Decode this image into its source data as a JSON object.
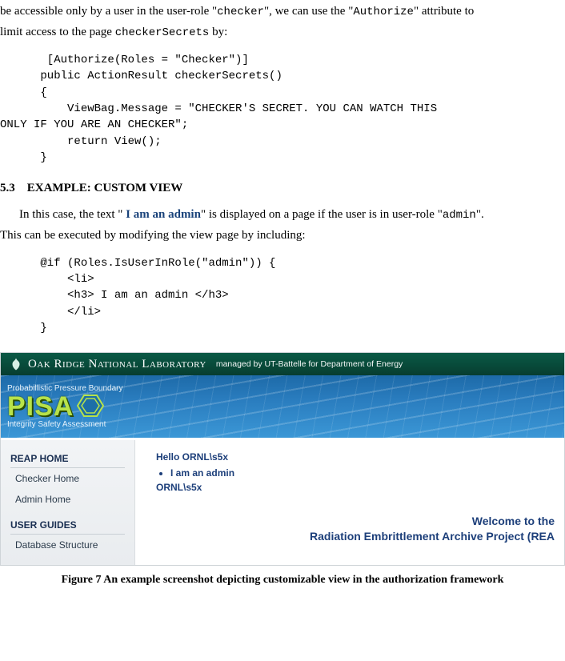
{
  "intro": {
    "line1_pre": "be accessible only by a user in the user-role \"",
    "role_checker": "checker",
    "line1_mid": "\", we can use the \"",
    "attr_authorize": "Authorize",
    "line1_post": "\" attribute to",
    "line2_pre": "limit access to the page ",
    "page_name": "checkerSecrets",
    "line2_post": " by:"
  },
  "code1": "       [Authorize(Roles = \"Checker\")]\n      public ActionResult checkerSecrets()\n      {\n          ViewBag.Message = \"CHECKER'S SECRET. YOU CAN WATCH THIS\nONLY IF YOU ARE AN CHECKER\";\n          return View();\n      }",
  "section": {
    "number": "5.3",
    "title": "EXAMPLE: CUSTOM VIEW"
  },
  "para2": {
    "pre": "In this case, the text \"",
    "bold": " I am an admin",
    "mid": "\" is displayed on a page if the user is in user-role \"",
    "role_admin": "admin",
    "post": "\".",
    "line2": "This can be executed by modifying the view page by including:"
  },
  "code2": "      @if (Roles.IsUserInRole(\"admin\")) {\n          <li>\n          <h3> I am an admin </h3>\n          </li>\n      }",
  "shot": {
    "lab_name": "Oak Ridge National Laboratory",
    "lab_managed": "managed by UT-Battelle for Department of Energy",
    "pisa_top": "Probabillistic Pressure Boundary",
    "pisa_logo": "PISA",
    "pisa_bottom": "Integrity Safety Assessment",
    "sidebar": {
      "head1": "REAP HOME",
      "item1": "Checker Home",
      "item2": "Admin Home",
      "head2": "USER GUIDES",
      "item3": "Database Structure"
    },
    "hello": "Hello ORNL\\s5x",
    "bullet": "I am an admin",
    "user": "ORNL\\s5x",
    "welcome_line1": "Welcome to the",
    "welcome_line2": "Radiation Embrittlement Archive Project (REA"
  },
  "caption": "Figure 7 An example screenshot depicting customizable view in the authorization framework"
}
